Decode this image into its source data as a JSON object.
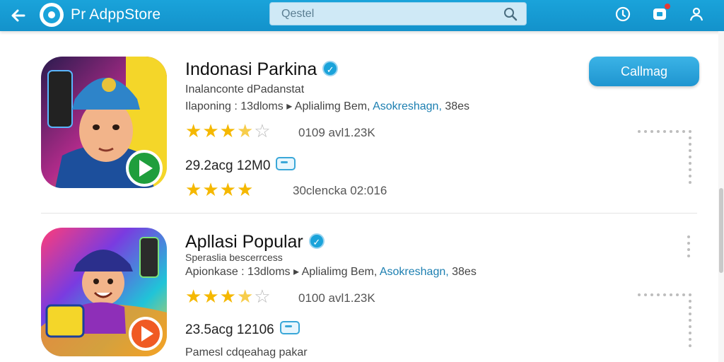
{
  "header": {
    "title": "Pr AdppStore",
    "search_placeholder": "Qestel"
  },
  "apps": [
    {
      "name": "Indonasi Parkina",
      "subtitle": "Inalanconte dPadanstat",
      "info_prefix": "Ilaponing : 13dloms  ▸  Aplialimg Bem,  ",
      "info_link": "Asokreshagn,",
      "info_suffix": " 38es",
      "rating": 3.5,
      "rating_meta": "0109 avl1.23K",
      "size_text": "29.2acg 12M0",
      "rating2": 4,
      "extra_meta": "30clencka 02:016",
      "button_label": "Callmag"
    },
    {
      "name": "Apllasi Popular",
      "subtitle": "Speraslia bescerrcess",
      "info_prefix": "Apionkase : 13dloms  ▸  Aplialimg Bem,  ",
      "info_link": "Asokreshagn,",
      "info_suffix": " 38es",
      "rating": 3.5,
      "rating_meta": "0100 avl1.23K",
      "size_text": "23.5acg 12106",
      "footer": "Pamesl cdqeahag pakar"
    }
  ],
  "colors": {
    "header_bg": "#1aa3da",
    "star": "#f5b800",
    "link": "#1c7fb1"
  }
}
